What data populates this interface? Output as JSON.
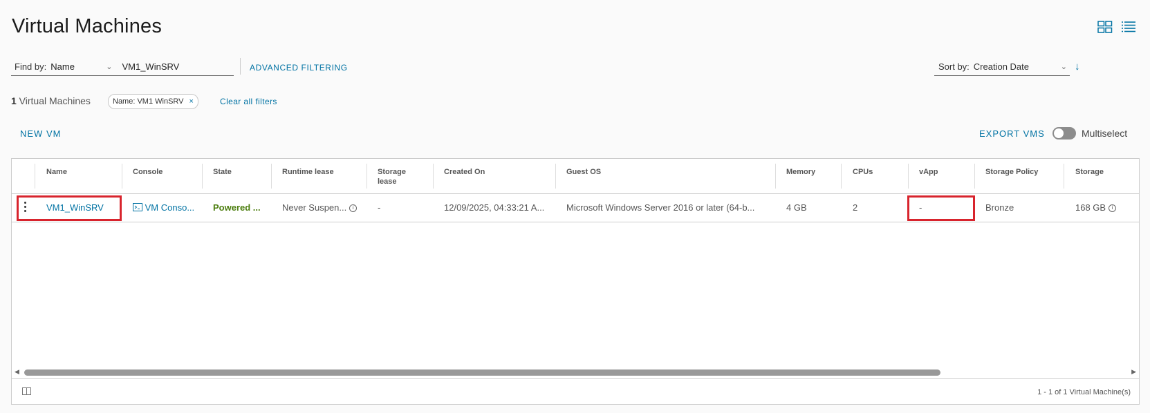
{
  "page": {
    "title": "Virtual Machines",
    "view_icons": [
      "card-view-icon",
      "list-view-icon"
    ]
  },
  "filter": {
    "find_by_label": "Find by:",
    "find_by_value": "Name",
    "search_value": "VM1_WinSRV",
    "advanced_filtering": "ADVANCED FILTERING"
  },
  "sort": {
    "label": "Sort by:",
    "value": "Creation Date",
    "direction_icon": "arrow-down-icon"
  },
  "results": {
    "count": "1",
    "count_label": " Virtual Machines",
    "pill": "Name:  VM1  WinSRV",
    "pill_close": "×",
    "clear_all": "Clear all filters"
  },
  "actions": {
    "new_vm": "NEW VM",
    "export_vms": "EXPORT VMS",
    "multiselect": "Multiselect",
    "multiselect_on": false
  },
  "grid": {
    "columns": [
      "Name",
      "Console",
      "State",
      "Runtime lease",
      "Storage lease",
      "Created On",
      "Guest OS",
      "Memory",
      "CPUs",
      "vApp",
      "Storage Policy",
      "Storage"
    ],
    "storage_lease_line1": "Storage",
    "storage_lease_line2": "lease",
    "rows": [
      {
        "name": "VM1_WinSRV",
        "console": "VM Conso...",
        "state": "Powered ...",
        "runtime_lease": "Never Suspen...",
        "storage_lease": "-",
        "created_on": "12/09/2025, 04:33:21 A...",
        "guest_os": "Microsoft Windows Server 2016 or later (64-b...",
        "memory": "4 GB",
        "cpus": "2",
        "vapp": "-",
        "storage_policy": "Bronze",
        "storage": "168 GB"
      }
    ],
    "footer": "1 - 1 of 1 Virtual Machine(s)"
  },
  "colors": {
    "link": "#0072a3",
    "highlight": "#d8242d",
    "state_green": "#4b7d0d"
  }
}
